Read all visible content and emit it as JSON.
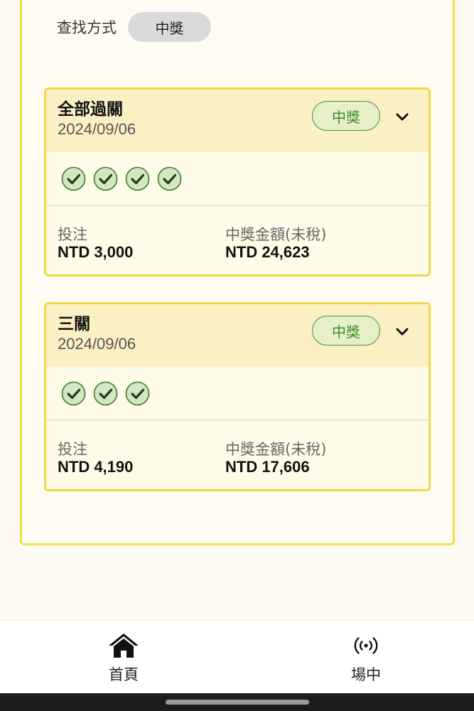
{
  "filter": {
    "label": "查找方式",
    "selected": "中獎"
  },
  "bets": [
    {
      "title": "全部過關",
      "date": "2024/09/06",
      "status": "中獎",
      "legs_won": 4,
      "stake_label": "投注",
      "stake_value": "NTD 3,000",
      "payout_label": "中獎金額(未稅)",
      "payout_value": "NTD 24,623"
    },
    {
      "title": "三關",
      "date": "2024/09/06",
      "status": "中獎",
      "legs_won": 3,
      "stake_label": "投注",
      "stake_value": "NTD 4,190",
      "payout_label": "中獎金額(未稅)",
      "payout_value": "NTD 17,606"
    }
  ],
  "nav": {
    "home_label": "首頁",
    "home_icon": "home-icon",
    "live_label": "場中",
    "live_icon": "live-broadcast-icon"
  },
  "colors": {
    "card_border": "#f0d840",
    "badge_green": "#3f8a2b",
    "background": "#fdfbf1"
  }
}
